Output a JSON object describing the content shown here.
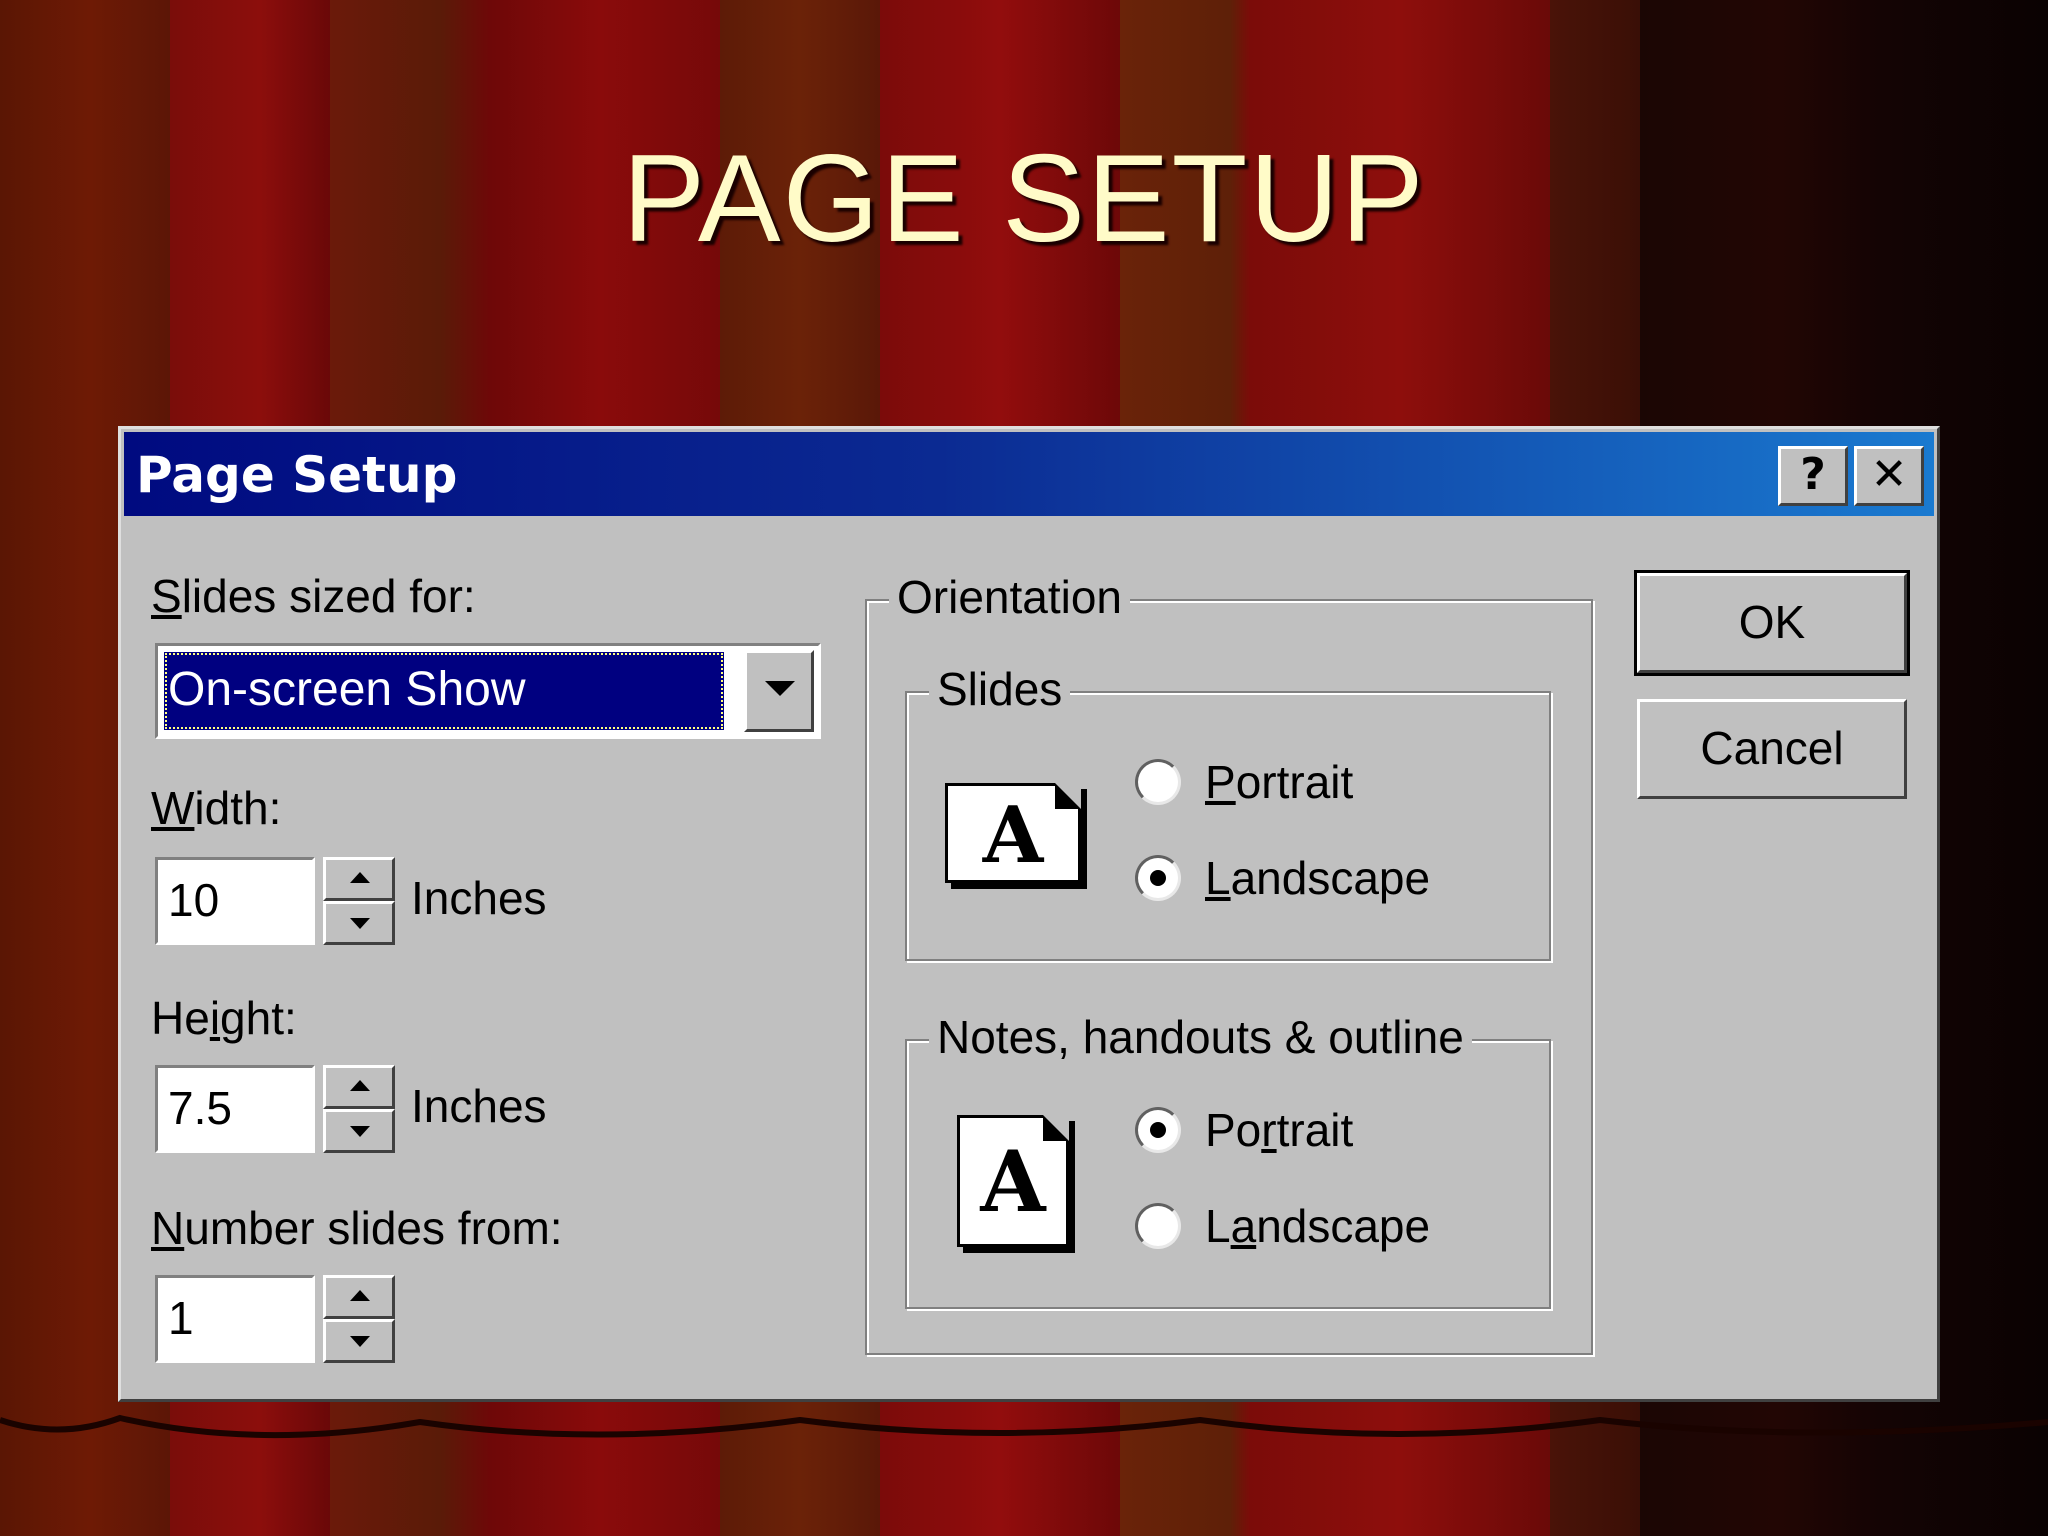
{
  "slide": {
    "title": "PAGE SETUP"
  },
  "dialog": {
    "title": "Page Setup",
    "help_button": "?",
    "close_button": "✕",
    "slides_sized_for": {
      "label_ul": "S",
      "label_rest": "lides sized for:",
      "value": "On-screen Show"
    },
    "width": {
      "label_ul": "W",
      "label_rest": "idth:",
      "value": "10",
      "unit": "Inches"
    },
    "height": {
      "label_pre": "He",
      "label_ul": "i",
      "label_rest": "ght:",
      "value": "7.5",
      "unit": "Inches"
    },
    "number_from": {
      "label_ul": "N",
      "label_rest": "umber slides from:",
      "value": "1"
    },
    "orientation": {
      "title": "Orientation",
      "slides": {
        "title": "Slides",
        "icon_letter": "A",
        "portrait": {
          "ul": "P",
          "rest": "ortrait",
          "selected": false
        },
        "landscape": {
          "ul": "L",
          "rest": "andscape",
          "selected": true
        }
      },
      "notes": {
        "title": "Notes, handouts & outline",
        "icon_letter": "A",
        "portrait": {
          "pre": "Po",
          "ul": "r",
          "rest": "trait",
          "selected": true
        },
        "landscape": {
          "pre": "L",
          "ul": "a",
          "rest": "ndscape",
          "selected": false
        }
      }
    },
    "ok_label": "OK",
    "cancel_label": "Cancel"
  },
  "colors": {
    "titlebar_start": "#000a80",
    "titlebar_end": "#1a7ad0",
    "dialog_face": "#c0c0c0",
    "title_text": "#fffbc8"
  }
}
